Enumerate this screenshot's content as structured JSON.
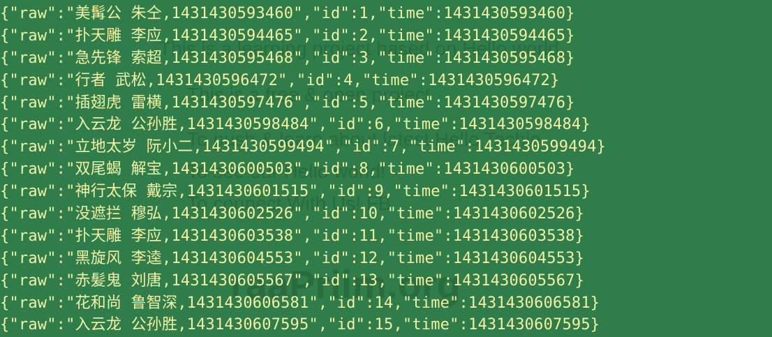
{
  "terminal": {
    "lines": [
      "{\"raw\":\"美髯公 朱仝,1431430593460\",\"id\":1,\"time\":1431430593460}",
      "{\"raw\":\"扑天雕 李应,1431430594465\",\"id\":2,\"time\":1431430594465}",
      "{\"raw\":\"急先锋 索超,1431430595468\",\"id\":3,\"time\":1431430595468}",
      "{\"raw\":\"行者 武松,1431430596472\",\"id\":4,\"time\":1431430596472}",
      "{\"raw\":\"插翅虎 雷横,1431430597476\",\"id\":5,\"time\":1431430597476}",
      "{\"raw\":\"入云龙 公孙胜,1431430598484\",\"id\":6,\"time\":1431430598484}",
      "{\"raw\":\"立地太岁 阮小二,1431430599494\",\"id\":7,\"time\":1431430599494}",
      "{\"raw\":\"双尾蝎 解宝,1431430600503\",\"id\":8,\"time\":1431430600503}",
      "{\"raw\":\"神行太保 戴宗,1431430601515\",\"id\":9,\"time\":1431430601515}",
      "{\"raw\":\"没遮拦 穆弘,1431430602526\",\"id\":10,\"time\":1431430602526}",
      "{\"raw\":\"扑天雕 李应,1431430603538\",\"id\":11,\"time\":1431430603538}",
      "{\"raw\":\"黑旋风 李逵,1431430604553\",\"id\":12,\"time\":1431430604553}",
      "{\"raw\":\"赤髪鬼 刘唐,1431430605567\",\"id\":13,\"time\":1431430605567}",
      "{\"raw\":\"花和尚 鲁智深,1431430606581\",\"id\":14,\"time\":1431430606581}",
      "{\"raw\":\"入云龙 公孙胜,1431430607595\",\"id\":15,\"time\":1431430607595}"
    ]
  },
  "watermark": {
    "line1": "This is a learning project based on Hello world.",
    "line2": "This is a free & open project",
    "line3": "To push & learn about latest Hello Techie",
    "line4": "To see our Hello world!",
    "line5": "To connect With Us! FB",
    "brand": "raaPriim.org"
  },
  "colors": {
    "background": "#2e7d4a",
    "text": "#f4f1a0"
  }
}
